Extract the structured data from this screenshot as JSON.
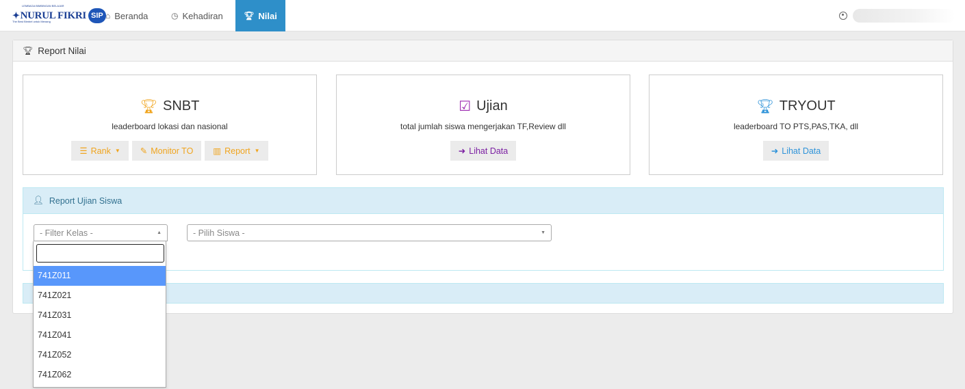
{
  "brand": {
    "name": "NURUL FIKRI",
    "badge": "SIP",
    "tagline_top": "LEMBAGA BIMBINGAN BELAJAR",
    "tagline_bottom": "The Best Bimbel untuk Menang"
  },
  "nav": {
    "items": [
      {
        "label": "Beranda",
        "icon": "home-icon"
      },
      {
        "label": "Kehadiran",
        "icon": "clock-icon"
      },
      {
        "label": "Nilai",
        "icon": "trophy-icon",
        "active": true
      }
    ]
  },
  "panel": {
    "title": "Report Nilai"
  },
  "cards": {
    "snbt": {
      "title": "SNBT",
      "desc": "leaderboard lokasi dan nasional",
      "btn_rank": "Rank",
      "btn_monitor": "Monitor TO",
      "btn_report": "Report"
    },
    "ujian": {
      "title": "Ujian",
      "desc": "total jumlah siswa mengerjakan TF,Review dll",
      "btn": "Lihat Data"
    },
    "tryout": {
      "title": "TRYOUT",
      "desc": "leaderboard TO PTS,PAS,TKA, dll",
      "btn": "Lihat Data"
    }
  },
  "report_ujian": {
    "title": "Report Ujian Siswa",
    "filter_kelas_placeholder": "- Filter Kelas -",
    "pilih_siswa_placeholder": "- Pilih Siswa -"
  },
  "dropdown": {
    "options": [
      "741Z011",
      "741Z021",
      "741Z031",
      "741Z041",
      "741Z052",
      "741Z062"
    ],
    "highlighted_index": 0
  },
  "colors": {
    "nav_active": "#2e8fc9",
    "snbt_accent": "#f0a41d",
    "ujian_accent": "#9c27b0",
    "tryout_accent": "#2e93d9",
    "info_heading": "#d9edf7",
    "highlight": "#5897fb"
  }
}
